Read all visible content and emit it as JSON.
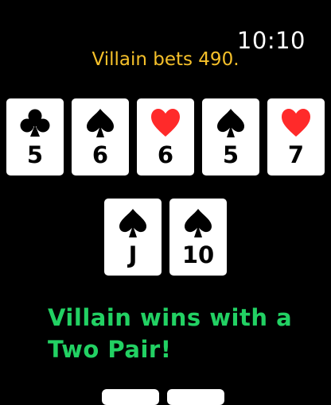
{
  "clock": "10:10",
  "status_message": "Villain bets 490.",
  "board": [
    {
      "rank": "5",
      "suit": "clubs-icon",
      "color": "#000000"
    },
    {
      "rank": "6",
      "suit": "spades-icon",
      "color": "#000000"
    },
    {
      "rank": "6",
      "suit": "hearts-icon",
      "color": "#ff2a2a"
    },
    {
      "rank": "5",
      "suit": "spades-icon",
      "color": "#000000"
    },
    {
      "rank": "7",
      "suit": "hearts-icon",
      "color": "#ff2a2a"
    }
  ],
  "hand": [
    {
      "rank": "J",
      "suit": "spades-icon",
      "color": "#000000"
    },
    {
      "rank": "10",
      "suit": "spades-icon",
      "color": "#000000"
    }
  ],
  "result_line1": "Villain wins with a",
  "result_line2": "Two Pair!",
  "colors": {
    "status": "#f5c02a",
    "result": "#22d163",
    "heart": "#ff2a2a"
  }
}
